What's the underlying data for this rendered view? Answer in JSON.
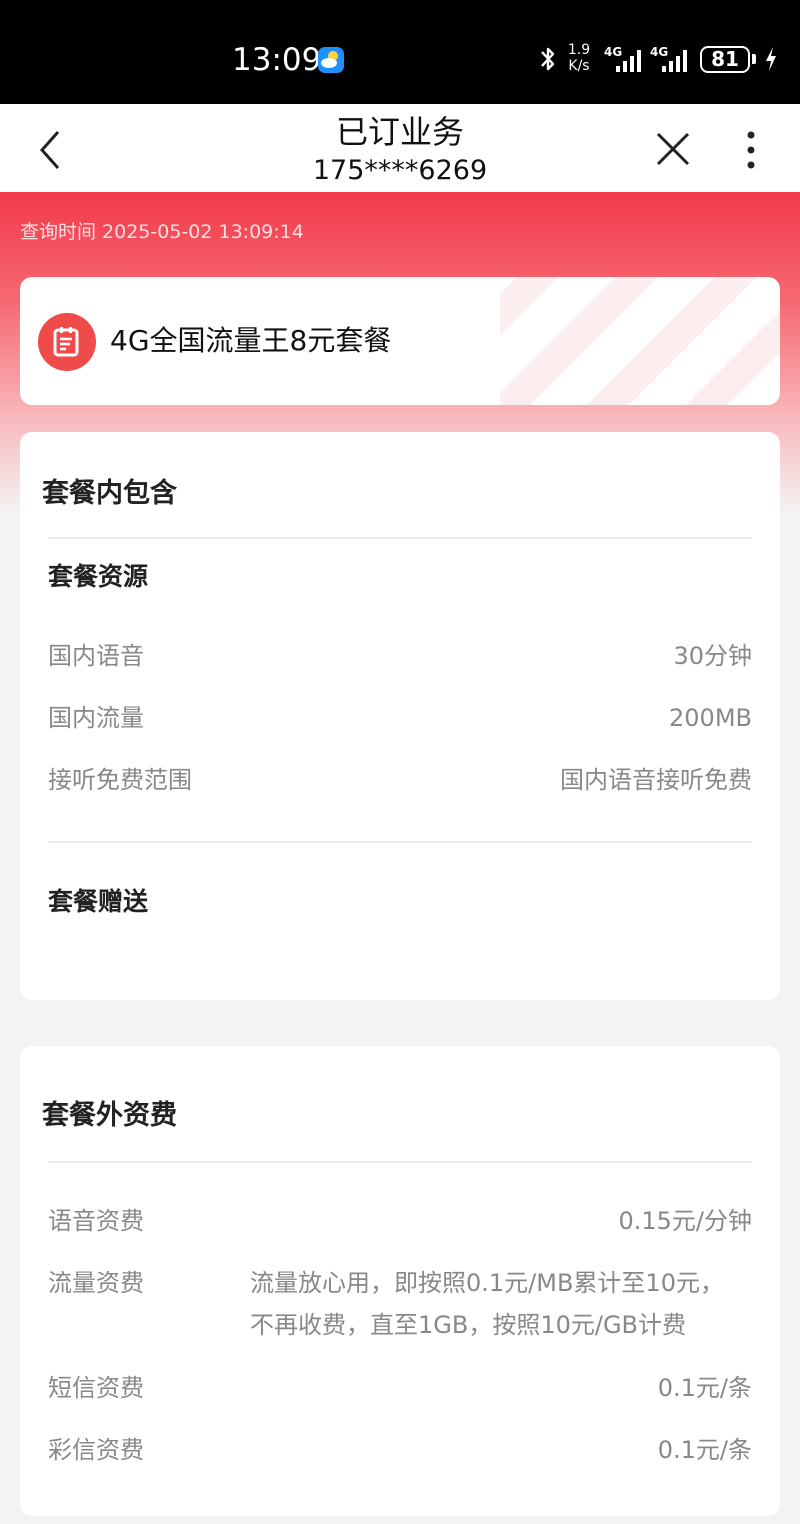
{
  "status_bar": {
    "time": "13:09",
    "net_speed_value": "1.9",
    "net_speed_unit": "K/s",
    "signal1_label": "4G",
    "signal2_label": "4G",
    "battery": "81"
  },
  "nav": {
    "title": "已订业务",
    "subtitle": "175****6269"
  },
  "query_time": "查询时间 2025-05-02 13:09:14",
  "plan": {
    "name": "4G全国流量王8元套餐"
  },
  "included": {
    "title": "套餐内包含",
    "resources_title": "套餐资源",
    "rows": [
      {
        "label": "国内语音",
        "value": "30分钟"
      },
      {
        "label": "国内流量",
        "value": "200MB"
      },
      {
        "label": "接听免费范围",
        "value": "国内语音接听免费"
      }
    ],
    "gift_title": "套餐赠送"
  },
  "extra": {
    "title": "套餐外资费",
    "voice": {
      "label": "语音资费",
      "value": "0.15元/分钟"
    },
    "data": {
      "label": "流量资费",
      "line1": "流量放心用，即按照0.1元/MB累计至10元，",
      "line2": "不再收费，直至1GB，按照10元/GB计费"
    },
    "sms": {
      "label": "短信资费",
      "value": "0.1元/条"
    },
    "mms": {
      "label": "彩信资费",
      "value": "0.1元/条"
    }
  }
}
